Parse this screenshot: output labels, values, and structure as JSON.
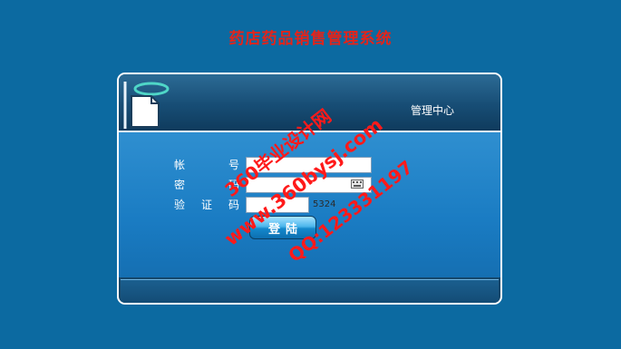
{
  "app": {
    "title": "药店药品销售管理系统"
  },
  "header": {
    "label": "管理中心"
  },
  "form": {
    "account": {
      "label": "帐号",
      "value": ""
    },
    "password": {
      "label": "密码",
      "value": ""
    },
    "captcha": {
      "label": "验证码",
      "value": "",
      "code": "5324"
    },
    "login_button": "登陆"
  },
  "watermark": {
    "line1": "360毕业设计网",
    "line2": "www.360bysj.com",
    "line3": "QQ:123331197",
    "color": "#ff0000"
  },
  "colors": {
    "background": "#0c6aa1",
    "title": "#e3241b",
    "panel": "#2f8fd0"
  }
}
